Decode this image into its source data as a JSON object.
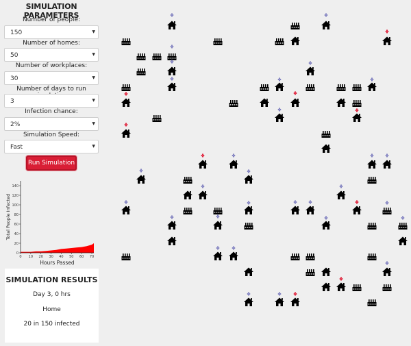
{
  "params": {
    "title": "SIMULATION PARAMETERS",
    "fields": [
      {
        "label": "Number of people:",
        "value": "150"
      },
      {
        "label": "Number of homes:",
        "value": "50"
      },
      {
        "label": "Number of workplaces:",
        "value": "30"
      },
      {
        "label": "Number of days to run simulation:",
        "value": "3"
      },
      {
        "label": "Infection chance:",
        "value": "2%"
      },
      {
        "label": "Simulation Speed:",
        "value": "Fast"
      }
    ],
    "run_label": "Run Simulation"
  },
  "chart_data": {
    "type": "area",
    "title": "",
    "xlabel": "Hours Passed",
    "ylabel": "Total People Infected",
    "x": [
      0,
      5,
      10,
      15,
      20,
      25,
      30,
      35,
      40,
      45,
      50,
      55,
      60,
      65,
      70,
      72
    ],
    "y": [
      2,
      2,
      2,
      3,
      3,
      4,
      5,
      6,
      8,
      9,
      10,
      11,
      12,
      14,
      17,
      20
    ],
    "xlim": [
      0,
      72
    ],
    "ylim": [
      0,
      150
    ],
    "xticks": [
      "0",
      "10",
      "20",
      "30",
      "40",
      "50",
      "60",
      "70"
    ],
    "yticks": [
      "0",
      "20",
      "40",
      "60",
      "80",
      "100",
      "120",
      "140"
    ],
    "color": "#ff0000"
  },
  "results": {
    "title": "SIMULATION RESULTS",
    "day_time": "Day 3, 0 hrs",
    "location": "Home",
    "infected_text": "20 in 150 infected"
  },
  "colors": {
    "healthy": "#8080c0",
    "infected": "#e0203a",
    "building": "#000000"
  },
  "map": {
    "buildings": [
      {
        "type": "home",
        "x": 251,
        "y": 37
      },
      {
        "type": "home",
        "x": 476,
        "y": 37
      },
      {
        "type": "work",
        "x": 431,
        "y": 38
      },
      {
        "type": "work",
        "x": 184,
        "y": 61
      },
      {
        "type": "work",
        "x": 318,
        "y": 61
      },
      {
        "type": "work",
        "x": 408,
        "y": 61
      },
      {
        "type": "home",
        "x": 431,
        "y": 60
      },
      {
        "type": "home",
        "x": 565,
        "y": 60
      },
      {
        "type": "work",
        "x": 206,
        "y": 83
      },
      {
        "type": "work",
        "x": 229,
        "y": 83
      },
      {
        "type": "work",
        "x": 251,
        "y": 83
      },
      {
        "type": "work",
        "x": 206,
        "y": 105
      },
      {
        "type": "home",
        "x": 251,
        "y": 104
      },
      {
        "type": "home",
        "x": 453,
        "y": 104
      },
      {
        "type": "work",
        "x": 184,
        "y": 128
      },
      {
        "type": "home",
        "x": 251,
        "y": 127
      },
      {
        "type": "work",
        "x": 386,
        "y": 128
      },
      {
        "type": "home",
        "x": 408,
        "y": 127
      },
      {
        "type": "work",
        "x": 453,
        "y": 128
      },
      {
        "type": "work",
        "x": 498,
        "y": 128
      },
      {
        "type": "work",
        "x": 521,
        "y": 128
      },
      {
        "type": "home",
        "x": 543,
        "y": 127
      },
      {
        "type": "home",
        "x": 184,
        "y": 150
      },
      {
        "type": "work",
        "x": 341,
        "y": 151
      },
      {
        "type": "home",
        "x": 386,
        "y": 150
      },
      {
        "type": "home",
        "x": 431,
        "y": 150
      },
      {
        "type": "home",
        "x": 498,
        "y": 150
      },
      {
        "type": "work",
        "x": 521,
        "y": 151
      },
      {
        "type": "work",
        "x": 229,
        "y": 173
      },
      {
        "type": "home",
        "x": 408,
        "y": 172
      },
      {
        "type": "home",
        "x": 521,
        "y": 172
      },
      {
        "type": "home",
        "x": 184,
        "y": 195
      },
      {
        "type": "work",
        "x": 476,
        "y": 196
      },
      {
        "type": "home",
        "x": 476,
        "y": 217
      },
      {
        "type": "home",
        "x": 341,
        "y": 240
      },
      {
        "type": "home",
        "x": 296,
        "y": 240
      },
      {
        "type": "home",
        "x": 543,
        "y": 240
      },
      {
        "type": "home",
        "x": 565,
        "y": 240
      },
      {
        "type": "home",
        "x": 206,
        "y": 262
      },
      {
        "type": "work",
        "x": 274,
        "y": 263
      },
      {
        "type": "home",
        "x": 363,
        "y": 262
      },
      {
        "type": "work",
        "x": 543,
        "y": 263
      },
      {
        "type": "home",
        "x": 274,
        "y": 285
      },
      {
        "type": "home",
        "x": 296,
        "y": 285
      },
      {
        "type": "home",
        "x": 498,
        "y": 285
      },
      {
        "type": "home",
        "x": 184,
        "y": 307
      },
      {
        "type": "work",
        "x": 274,
        "y": 308
      },
      {
        "type": "work",
        "x": 318,
        "y": 308
      },
      {
        "type": "home",
        "x": 363,
        "y": 307
      },
      {
        "type": "home",
        "x": 431,
        "y": 307
      },
      {
        "type": "home",
        "x": 453,
        "y": 307
      },
      {
        "type": "home",
        "x": 521,
        "y": 307
      },
      {
        "type": "work",
        "x": 565,
        "y": 308
      },
      {
        "type": "home",
        "x": 251,
        "y": 329
      },
      {
        "type": "home",
        "x": 318,
        "y": 329
      },
      {
        "type": "work",
        "x": 363,
        "y": 330
      },
      {
        "type": "home",
        "x": 476,
        "y": 329
      },
      {
        "type": "work",
        "x": 543,
        "y": 330
      },
      {
        "type": "work",
        "x": 588,
        "y": 330
      },
      {
        "type": "home",
        "x": 251,
        "y": 352
      },
      {
        "type": "home",
        "x": 588,
        "y": 352
      },
      {
        "type": "work",
        "x": 184,
        "y": 375
      },
      {
        "type": "home",
        "x": 318,
        "y": 374
      },
      {
        "type": "home",
        "x": 341,
        "y": 374
      },
      {
        "type": "work",
        "x": 431,
        "y": 375
      },
      {
        "type": "work",
        "x": 453,
        "y": 375
      },
      {
        "type": "work",
        "x": 543,
        "y": 375
      },
      {
        "type": "home",
        "x": 363,
        "y": 397
      },
      {
        "type": "work",
        "x": 453,
        "y": 398
      },
      {
        "type": "home",
        "x": 476,
        "y": 397
      },
      {
        "type": "home",
        "x": 565,
        "y": 397
      },
      {
        "type": "home",
        "x": 476,
        "y": 419
      },
      {
        "type": "home",
        "x": 498,
        "y": 419
      },
      {
        "type": "work",
        "x": 521,
        "y": 420
      },
      {
        "type": "work",
        "x": 565,
        "y": 420
      },
      {
        "type": "home",
        "x": 363,
        "y": 441
      },
      {
        "type": "home",
        "x": 408,
        "y": 441
      },
      {
        "type": "home",
        "x": 431,
        "y": 441
      },
      {
        "type": "work",
        "x": 543,
        "y": 442
      }
    ],
    "people": [
      {
        "x": 251,
        "y": 22,
        "s": "h"
      },
      {
        "x": 476,
        "y": 22,
        "s": "h"
      },
      {
        "x": 565,
        "y": 46,
        "s": "i"
      },
      {
        "x": 251,
        "y": 68,
        "s": "h"
      },
      {
        "x": 251,
        "y": 90,
        "s": "h"
      },
      {
        "x": 251,
        "y": 115,
        "s": "h"
      },
      {
        "x": 453,
        "y": 92,
        "s": "h"
      },
      {
        "x": 408,
        "y": 116,
        "s": "h"
      },
      {
        "x": 431,
        "y": 136,
        "s": "i"
      },
      {
        "x": 184,
        "y": 137,
        "s": "i"
      },
      {
        "x": 543,
        "y": 116,
        "s": "h"
      },
      {
        "x": 521,
        "y": 161,
        "s": "i"
      },
      {
        "x": 408,
        "y": 160,
        "s": "h"
      },
      {
        "x": 184,
        "y": 182,
        "s": "i"
      },
      {
        "x": 206,
        "y": 249,
        "s": "h"
      },
      {
        "x": 296,
        "y": 227,
        "s": "i"
      },
      {
        "x": 341,
        "y": 227,
        "s": "h"
      },
      {
        "x": 363,
        "y": 250,
        "s": "h"
      },
      {
        "x": 543,
        "y": 227,
        "s": "h"
      },
      {
        "x": 565,
        "y": 227,
        "s": "h"
      },
      {
        "x": 296,
        "y": 272,
        "s": "h"
      },
      {
        "x": 498,
        "y": 272,
        "s": "h"
      },
      {
        "x": 184,
        "y": 295,
        "s": "h"
      },
      {
        "x": 363,
        "y": 296,
        "s": "h"
      },
      {
        "x": 431,
        "y": 295,
        "s": "h"
      },
      {
        "x": 453,
        "y": 295,
        "s": "h"
      },
      {
        "x": 521,
        "y": 295,
        "s": "i"
      },
      {
        "x": 565,
        "y": 296,
        "s": "h"
      },
      {
        "x": 251,
        "y": 317,
        "s": "h"
      },
      {
        "x": 318,
        "y": 316,
        "s": "h"
      },
      {
        "x": 476,
        "y": 318,
        "s": "h"
      },
      {
        "x": 588,
        "y": 318,
        "s": "h"
      },
      {
        "x": 318,
        "y": 362,
        "s": "h"
      },
      {
        "x": 341,
        "y": 362,
        "s": "h"
      },
      {
        "x": 565,
        "y": 384,
        "s": "h"
      },
      {
        "x": 498,
        "y": 407,
        "s": "i"
      },
      {
        "x": 363,
        "y": 429,
        "s": "h"
      },
      {
        "x": 408,
        "y": 429,
        "s": "h"
      },
      {
        "x": 431,
        "y": 429,
        "s": "i"
      }
    ]
  }
}
